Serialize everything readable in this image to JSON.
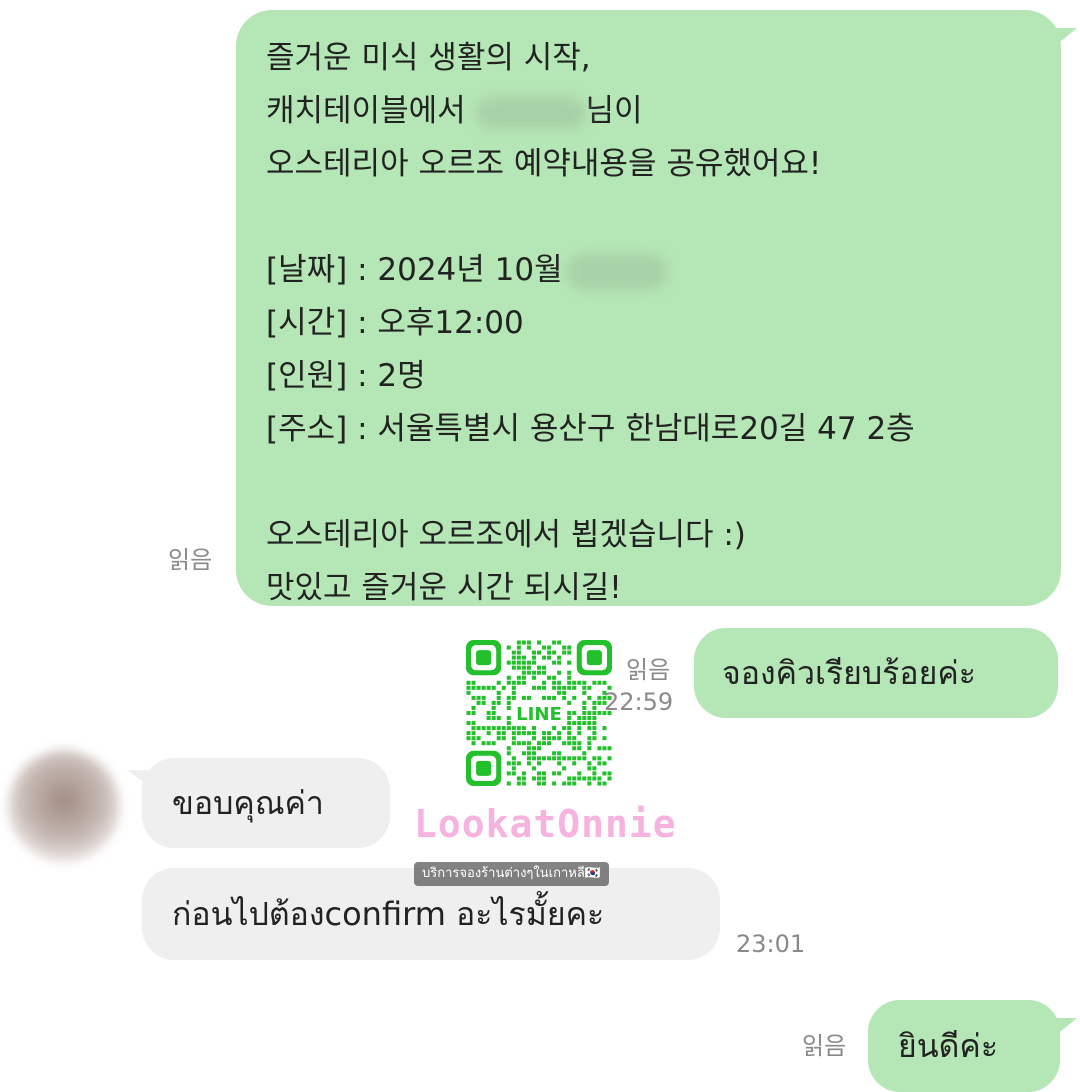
{
  "messages": {
    "reservation": {
      "read_label": "읽음",
      "lines": [
        "즐거운 미식 생활의 시작,",
        "캐치테이블에서 ",
        "님이",
        "오스테리아 오르조 예약내용을 공유했어요!",
        "[날짜] : 2024년 10월",
        "[시간] : 오후12:00",
        "[인원] : 2명",
        "[주소] : 서울특별시 용산구 한남대로20길 47 2층",
        "오스테리아 오르조에서 뵙겠습니다 :)",
        "맛있고 즐거운 시간 되시길!"
      ]
    },
    "queue": {
      "text": "จองคิวเรียบร้อยค่ะ",
      "read_label": "읽음",
      "time": "22:59"
    },
    "thanks": {
      "text": "ขอบคุณค่า"
    },
    "question": {
      "text": "ก่อนไปต้องconfirm อะไรมั้ยคะ",
      "time": "23:01"
    },
    "welcome": {
      "text": "ยินดีค่ะ",
      "read_label": "읽음"
    }
  },
  "watermark": {
    "brand": "LookatOnnie",
    "qr_label": "LINE",
    "subtitle": "บริการจองร้านต่างๆในเกาหลี🇰🇷",
    "qr_color": "#22c02a"
  },
  "colors": {
    "outgoing": "#b5e6b5",
    "incoming": "#efefef"
  }
}
